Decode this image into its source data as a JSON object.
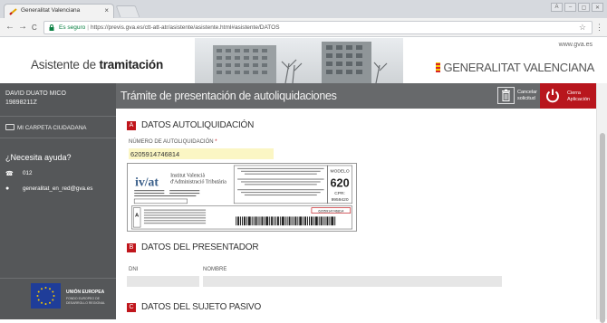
{
  "browser": {
    "tab_title": "Generalitat Valenciana",
    "tab_close": "×",
    "secure_label": "Es seguro",
    "url": "https://previs.gva.es/ctt-att-atr/asistente/asistente.html#asistente/DATOS",
    "star": "☆",
    "menu": "⋮",
    "win_controls": [
      "A",
      "–",
      "▢",
      "✕"
    ],
    "nav": {
      "back": "←",
      "forward": "→",
      "reload": "C"
    }
  },
  "header": {
    "title_prefix": "Asistente de ",
    "title_bold": "tramitación",
    "www": "www.gva.es",
    "org_name": "GENERALITAT VALENCIANA"
  },
  "sidebar": {
    "user_name": "DAVID DUATO MICO",
    "user_id": "19898211Z",
    "carpeta_label": "MI CARPETA CIUDADANA",
    "help_title": "¿Necesita ayuda?",
    "phone": "012",
    "email": "generalitat_en_red@gva.es",
    "eu_title": "UNIÓN EUROPEA",
    "eu_sub": "FONDO EUROPEO DE DESARROLLO REGIONAL"
  },
  "main": {
    "title": "Trámite de presentación de autoliquidaciones",
    "cancel_label_1": "Cancelar",
    "cancel_label_2": "solicitud",
    "close_label_1": "Cierra",
    "close_label_2": "Aplicación"
  },
  "sections": {
    "a_letter": "A",
    "a_title": "DATOS AUTOLIQUIDACIÓN",
    "num_label": "NÚMERO DE AUTOLIQUIDACIÓN",
    "num_required": "*",
    "num_value": "6205914746814",
    "b_letter": "B",
    "b_title": "DATOS DEL PRESENTADOR",
    "dni_label": "DNI",
    "nombre_label": "NOMBRE",
    "c_letter": "C",
    "c_title": "DATOS DEL SUJETO PASIVO"
  },
  "form_image": {
    "logo": "iv/at",
    "institute_1": "Institut Valencià",
    "institute_2": "d'Administració Tributària",
    "modelo_label": "MODELO",
    "modelo_number": "620",
    "cpr_label": "CPR:",
    "cpr_value": "9959420",
    "box_letter": "A",
    "barcode_number": "6205914746814"
  },
  "colors": {
    "accent_red": "#c0161c",
    "sidebar": "#555759",
    "header_strip": "#67696b",
    "input_yellow": "#fbf6c4"
  }
}
